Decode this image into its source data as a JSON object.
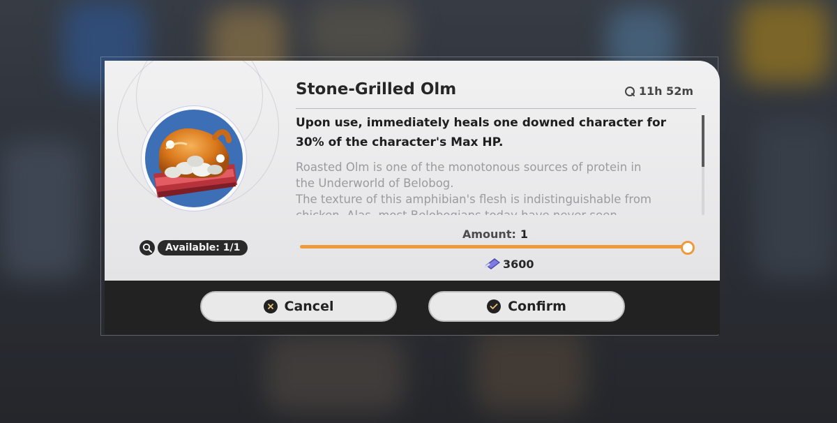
{
  "item": {
    "name": "Stone-Grilled Olm",
    "timer": "11h 52m",
    "effect": "Upon use, immediately heals one downed character for 30% of the character's Max HP.",
    "lore_lines": [
      "Roasted Olm is one of the monotonous sources of protein in",
      "the Underworld of Belobog.",
      "The texture of this amphibian's flesh is indistinguishable from",
      "chicken. Alas, most Belobogians today have never seen"
    ],
    "available": "Available: 1/1"
  },
  "amount": {
    "label": "Amount:",
    "value": "1",
    "level_fraction": 1.0
  },
  "cost": {
    "value": "3600",
    "icon": "credit-ticket-icon"
  },
  "buttons": {
    "cancel": "Cancel",
    "confirm": "Confirm"
  },
  "colors": {
    "accent": "#ef9a3a",
    "item_bg": "#3d6fb6",
    "footer": "#222222"
  }
}
